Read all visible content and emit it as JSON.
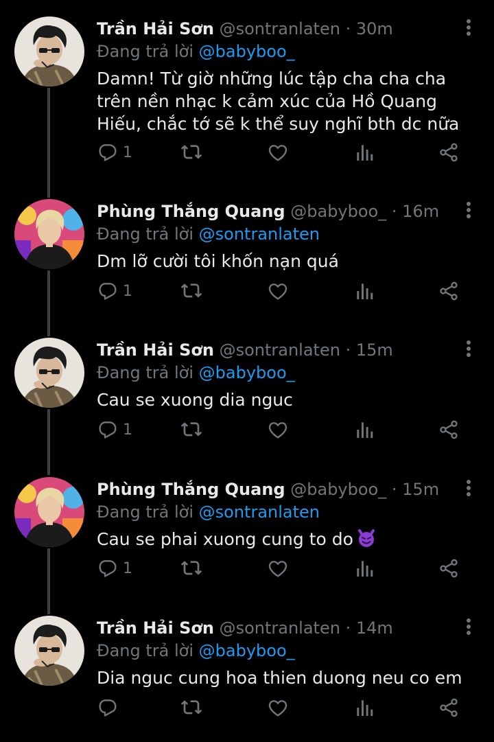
{
  "colors": {
    "background": "#000000",
    "text": "#e7e9ea",
    "muted": "#71767b",
    "accent": "#1d9bf0",
    "thread_line": "#3d4043"
  },
  "replying_label": "Đang trả lời",
  "tweets": [
    {
      "name": "Trần Hải Sơn",
      "handle": "@sontranlaten",
      "dot": "·",
      "time": "30m",
      "reply_to": "@babyboo_",
      "text": "Damn! Từ giờ những lúc tập cha cha cha trên nền nhạc k cảm xúc của Hồ Quang Hiếu, chắc tớ sẽ k thể suy nghĩ bth dc nữa",
      "reply_count": "1",
      "avatar": "avatar-son"
    },
    {
      "name": "Phùng Thắng Quang",
      "handle": "@babyboo_",
      "dot": "·",
      "time": "16m",
      "reply_to": "@sontranlaten",
      "text": "Dm lỡ cười tôi khốn nạn quá",
      "reply_count": "1",
      "avatar": "avatar-quang"
    },
    {
      "name": "Trần Hải Sơn",
      "handle": "@sontranlaten",
      "dot": "·",
      "time": "15m",
      "reply_to": "@babyboo_",
      "text": "Cau se xuong dia nguc",
      "reply_count": "1",
      "avatar": "avatar-son"
    },
    {
      "name": "Phùng Thắng Quang",
      "handle": "@babyboo_",
      "dot": "·",
      "time": "15m",
      "reply_to": "@sontranlaten",
      "text": "Cau se phai xuong cung to do",
      "emoji": "smiling-devil-emoji",
      "reply_count": "1",
      "avatar": "avatar-quang"
    },
    {
      "name": "Trần Hải Sơn",
      "handle": "@sontranlaten",
      "dot": "·",
      "time": "14m",
      "reply_to": "@babyboo_",
      "text": "Dia nguc cung hoa thien duong neu co em",
      "reply_count": "",
      "avatar": "avatar-son"
    }
  ]
}
